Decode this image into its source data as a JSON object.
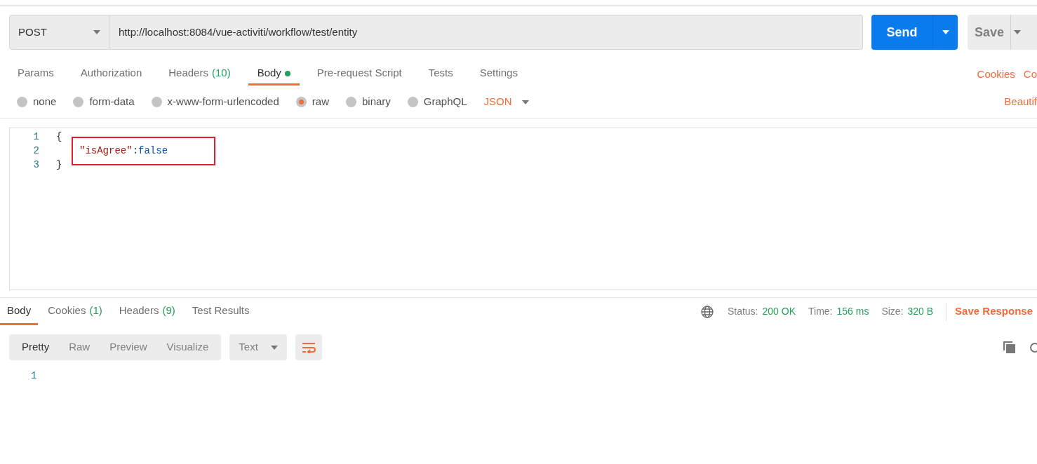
{
  "request": {
    "method": "POST",
    "url": "http://localhost:8084/vue-activiti/workflow/test/entity",
    "send": "Send",
    "save": "Save"
  },
  "request_tabs": [
    {
      "label": "Params",
      "selected": false,
      "dot": false
    },
    {
      "label": "Authorization",
      "selected": false,
      "dot": false
    },
    {
      "label": "Headers",
      "count": "(10)",
      "selected": false,
      "dot": false
    },
    {
      "label": "Body",
      "selected": true,
      "dot": true
    },
    {
      "label": "Pre-request Script",
      "selected": false,
      "dot": false
    },
    {
      "label": "Tests",
      "selected": false,
      "dot": false
    },
    {
      "label": "Settings",
      "selected": false,
      "dot": false
    }
  ],
  "right_links": [
    "Cookies",
    "Co"
  ],
  "body_types": [
    {
      "label": "none",
      "selected": false
    },
    {
      "label": "form-data",
      "selected": false
    },
    {
      "label": "x-www-form-urlencoded",
      "selected": false
    },
    {
      "label": "raw",
      "selected": true
    },
    {
      "label": "binary",
      "selected": false
    },
    {
      "label": "GraphQL",
      "selected": false
    }
  ],
  "body_format": "JSON",
  "beautify": "Beautif",
  "editor": {
    "lines": [
      {
        "number": "1",
        "highlighted": false,
        "tokens": [
          {
            "kind": "punct",
            "text": "{"
          }
        ]
      },
      {
        "number": "2",
        "highlighted": true,
        "tokens": [
          {
            "kind": "key",
            "text": "\"isAgree\""
          },
          {
            "kind": "plain",
            "text": ":"
          },
          {
            "kind": "value",
            "text": "false"
          }
        ]
      },
      {
        "number": "3",
        "highlighted": false,
        "tokens": [
          {
            "kind": "punct",
            "text": "}"
          }
        ]
      }
    ]
  },
  "response": {
    "tabs": [
      {
        "label": "Body",
        "selected": true
      },
      {
        "label": "Cookies",
        "count": "(1)",
        "selected": false
      },
      {
        "label": "Headers",
        "count": "(9)",
        "selected": false
      },
      {
        "label": "Test Results",
        "selected": false
      }
    ],
    "stats": [
      {
        "label": "Status:",
        "value": "200 OK"
      },
      {
        "label": "Time:",
        "value": "156 ms"
      },
      {
        "label": "Size:",
        "value": "320 B"
      }
    ],
    "save_response": "Save Response",
    "view_modes": [
      {
        "label": "Pretty",
        "selected": true
      },
      {
        "label": "Raw",
        "selected": false
      },
      {
        "label": "Preview",
        "selected": false
      },
      {
        "label": "Visualize",
        "selected": false
      }
    ],
    "format": "Text",
    "line_numbers": [
      "1"
    ]
  }
}
